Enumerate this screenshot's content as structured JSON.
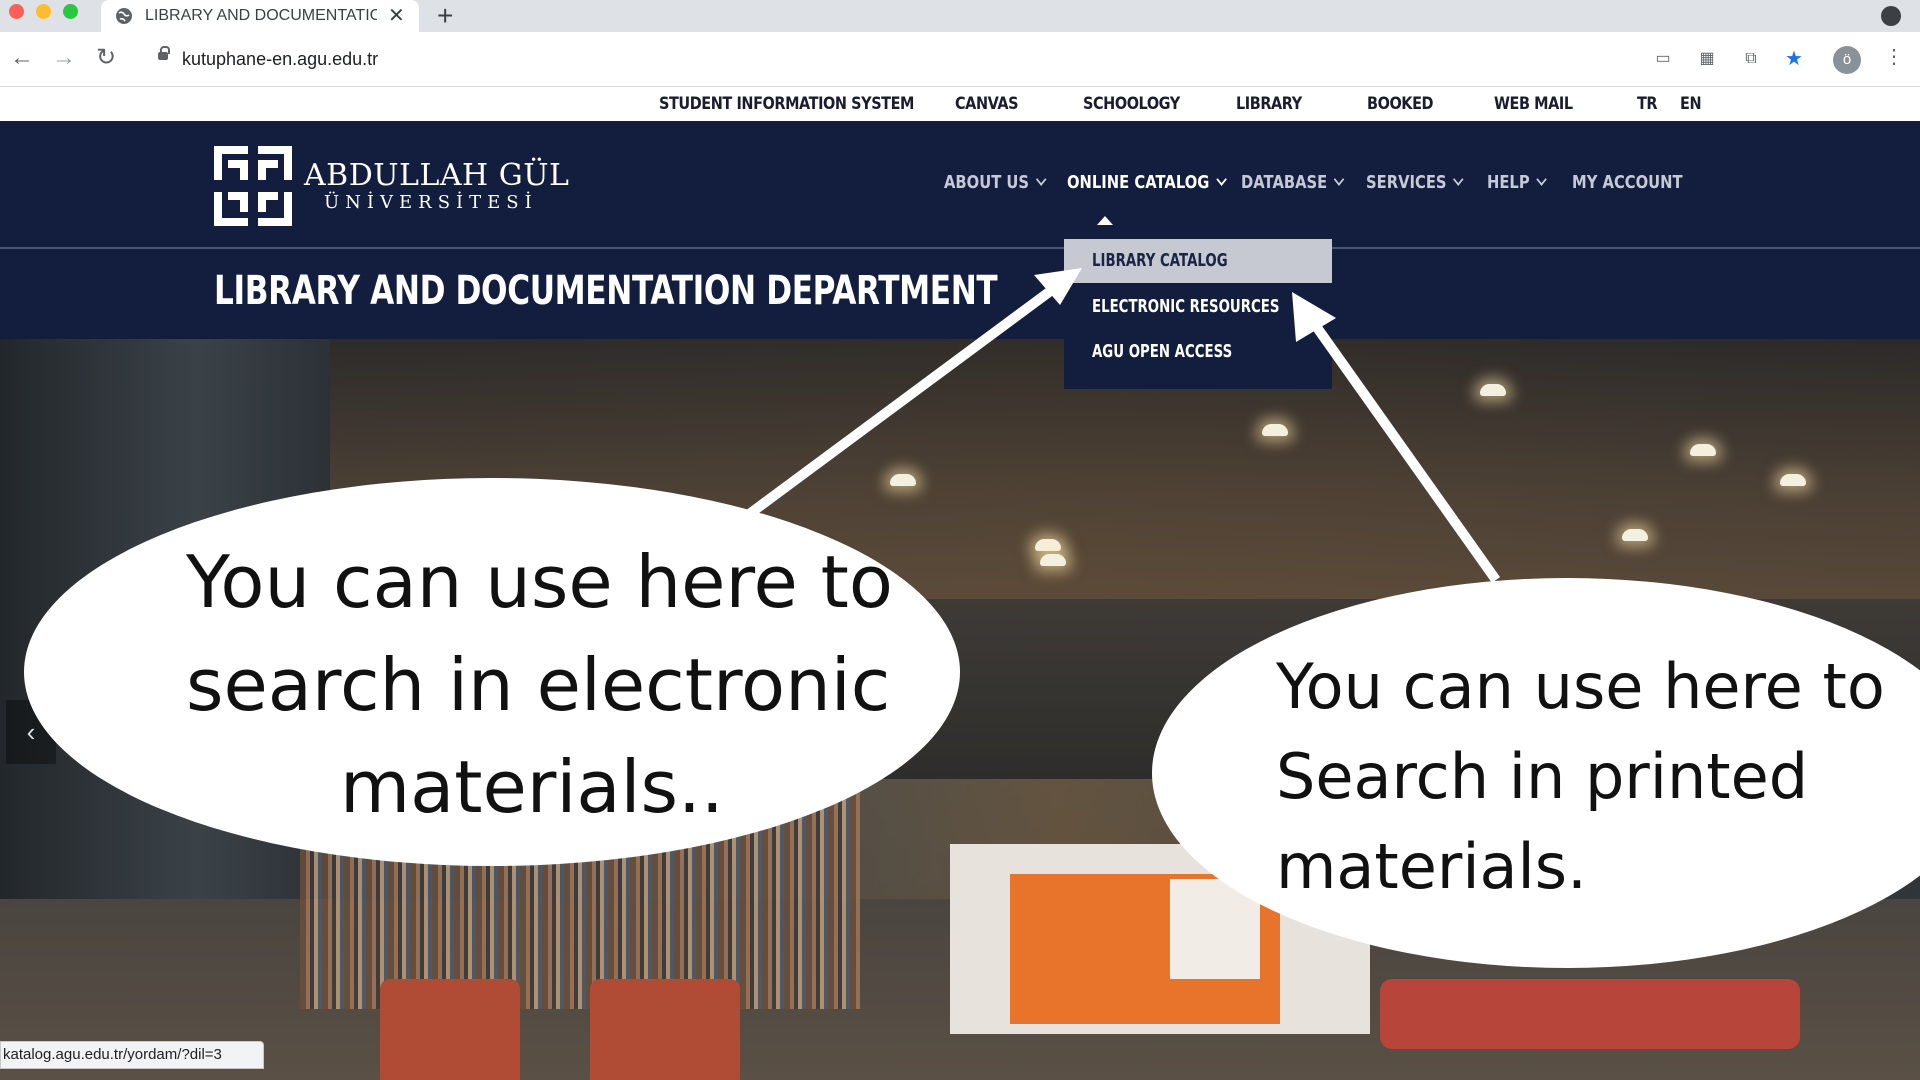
{
  "browser": {
    "tab_title": "LIBRARY AND DOCUMENTATIC",
    "tab_close": "✕",
    "new_tab": "+",
    "url": "kutuphane-en.agu.edu.tr",
    "profile_initial": "ö",
    "status_url": "katalog.agu.edu.tr/yordam/?dil=3",
    "icons": [
      "back-arrow-icon",
      "forward-arrow-icon",
      "reload-icon",
      "lock-icon",
      "cast-icon",
      "qr-code-icon",
      "translate-icon",
      "bookmark-star-icon",
      "more-vert-icon"
    ],
    "colors": {
      "tabbar": "#dee1e6",
      "star": "#1a73e8"
    }
  },
  "top_links": {
    "items": [
      "STUDENT INFORMATION SYSTEM",
      "CANVAS",
      "SCHOOLOGY",
      "LIBRARY",
      "BOOKED",
      "WEB MAIL",
      "TR",
      "EN"
    ]
  },
  "logo": {
    "name": "ABDULLAH GÜL",
    "sub": "ÜNİVERSİTESİ"
  },
  "main_nav": {
    "items": [
      "ABOUT US",
      "ONLINE CATALOG",
      "DATABASE",
      "SERVICES",
      "HELP",
      "MY ACCOUNT"
    ],
    "active": "ONLINE CATALOG"
  },
  "department_title": "LIBRARY AND DOCUMENTATION DEPARTMENT",
  "dropdown": {
    "items": [
      "LIBRARY CATALOG",
      "ELECTRONIC RESOURCES",
      "AGU OPEN ACCESS"
    ],
    "highlighted": "LIBRARY CATALOG"
  },
  "callouts": {
    "left": [
      "You can use here to",
      "search in electronic",
      "materials.."
    ],
    "right": [
      "You can use here to",
      "Search in printed",
      "materials."
    ]
  },
  "slider": {
    "prev_glyph": "‹"
  },
  "colors": {
    "header_bg": "#131e3f",
    "accent_orange": "#e8742b"
  }
}
